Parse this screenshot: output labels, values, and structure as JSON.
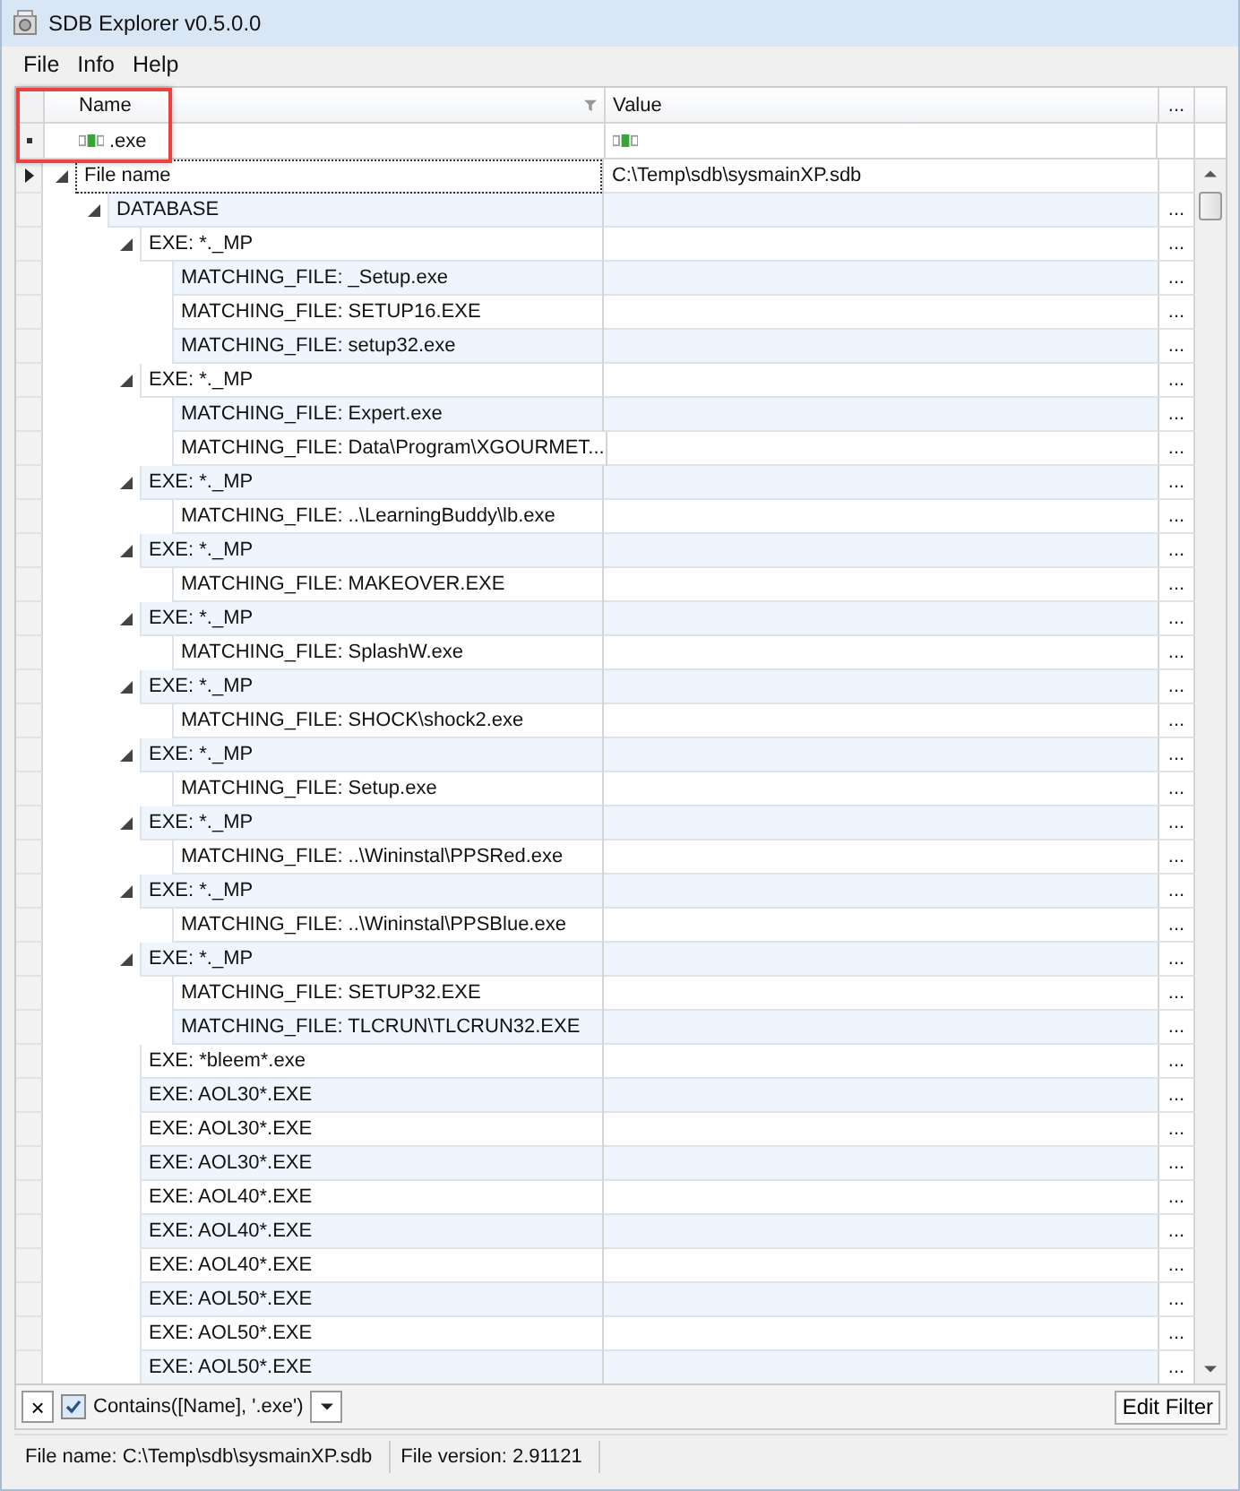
{
  "window": {
    "title": "SDB Explorer v0.5.0.0"
  },
  "menu": [
    "File",
    "Info",
    "Help"
  ],
  "grid": {
    "columns": [
      {
        "label": "Name",
        "filtered": true
      },
      {
        "label": "Value",
        "filtered": false
      }
    ],
    "header_button": "...",
    "filter_row": {
      "name": ".exe"
    },
    "rows": [
      {
        "name": "File name",
        "value": "C:\\Temp\\sdb\\sysmainXP.sdb",
        "selected": true,
        "expanded": true,
        "children": [
          {
            "name": "DATABASE",
            "selected": false,
            "expanded": true,
            "children": [
              {
                "name": "EXE: *._MP",
                "selected": false,
                "expanded": true,
                "children": [
                  {
                    "name": "MATCHING_FILE: _Setup.exe",
                    "selected": false
                  },
                  {
                    "name": "MATCHING_FILE: SETUP16.EXE",
                    "selected": false
                  },
                  {
                    "name": "MATCHING_FILE: setup32.exe",
                    "selected": false
                  }
                ]
              },
              {
                "name": "EXE: *._MP",
                "selected": false,
                "expanded": true,
                "children": [
                  {
                    "name": "MATCHING_FILE: Expert.exe",
                    "selected": false
                  },
                  {
                    "name": "MATCHING_FILE: Data\\Program\\XGOURMET....",
                    "selected": false
                  }
                ]
              },
              {
                "name": "EXE: *._MP",
                "selected": false,
                "expanded": true,
                "children": [
                  {
                    "name": "MATCHING_FILE: ..\\LearningBuddy\\lb.exe",
                    "selected": false
                  }
                ]
              },
              {
                "name": "EXE: *._MP",
                "selected": false,
                "expanded": true,
                "children": [
                  {
                    "name": "MATCHING_FILE: MAKEOVER.EXE",
                    "selected": false
                  }
                ]
              },
              {
                "name": "EXE: *._MP",
                "selected": false,
                "expanded": true,
                "children": [
                  {
                    "name": "MATCHING_FILE: SplashW.exe",
                    "selected": false
                  }
                ]
              },
              {
                "name": "EXE: *._MP",
                "selected": false,
                "expanded": true,
                "children": [
                  {
                    "name": "MATCHING_FILE: SHOCK\\shock2.exe",
                    "selected": false
                  }
                ]
              },
              {
                "name": "EXE: *._MP",
                "selected": false,
                "expanded": true,
                "children": [
                  {
                    "name": "MATCHING_FILE: Setup.exe",
                    "selected": false
                  }
                ]
              },
              {
                "name": "EXE: *._MP",
                "selected": false,
                "expanded": true,
                "children": [
                  {
                    "name": "MATCHING_FILE: ..\\Wininstal\\PPSRed.exe",
                    "selected": false
                  }
                ]
              },
              {
                "name": "EXE: *._MP",
                "selected": false,
                "expanded": true,
                "children": [
                  {
                    "name": "MATCHING_FILE: ..\\Wininstal\\PPSBlue.exe",
                    "selected": false
                  }
                ]
              },
              {
                "name": "EXE: *._MP",
                "selected": false,
                "expanded": true,
                "children": [
                  {
                    "name": "MATCHING_FILE: SETUP32.EXE",
                    "selected": false
                  },
                  {
                    "name": "MATCHING_FILE: TLCRUN\\TLCRUN32.EXE",
                    "selected": false
                  }
                ]
              },
              {
                "name": "EXE: *bleem*.exe",
                "selected": false
              },
              {
                "name": "EXE: AOL30*.EXE",
                "selected": false
              },
              {
                "name": "EXE: AOL30*.EXE",
                "selected": false
              },
              {
                "name": "EXE: AOL30*.EXE",
                "selected": false
              },
              {
                "name": "EXE: AOL40*.EXE",
                "selected": false
              },
              {
                "name": "EXE: AOL40*.EXE",
                "selected": false
              },
              {
                "name": "EXE: AOL40*.EXE",
                "selected": false
              },
              {
                "name": "EXE: AOL50*.EXE",
                "selected": false
              },
              {
                "name": "EXE: AOL50*.EXE",
                "selected": false
              },
              {
                "name": "EXE: AOL50*.EXE",
                "selected": false
              }
            ]
          }
        ]
      }
    ],
    "row_button": "..."
  },
  "filter_bar": {
    "close": "×",
    "enabled": true,
    "expression": "Contains([Name], '.exe')",
    "edit_button": "Edit Filter"
  },
  "status_bar": [
    "File name: C:\\Temp\\sdb\\sysmainXP.sdb",
    "File version: 2.91121"
  ]
}
